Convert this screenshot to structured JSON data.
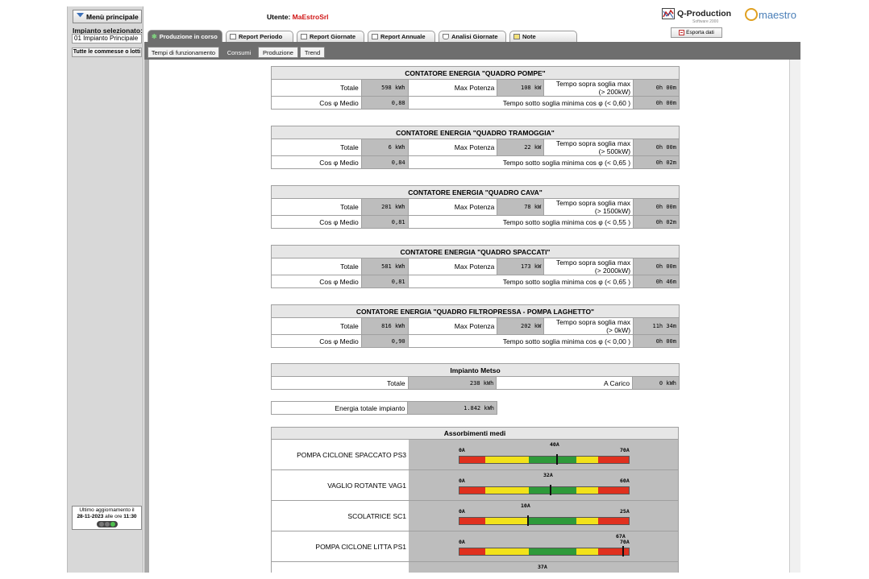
{
  "sidebar": {
    "menu_button": "Menù principale",
    "impianto_label": "Impianto selezionato:",
    "impianto_value": "01 Impianto Principale",
    "commesse_button": "Tutte le commesse o lotti",
    "update_line1": "Ultimo aggiornamento il",
    "update_date": "28-11-2023",
    "update_mid": "alle ore",
    "update_time": "11:30"
  },
  "header": {
    "user_label": "Utente:",
    "user_name": "MaEstroSrl",
    "brand": "Q-Production",
    "brand_sub": "Software 2000",
    "brand2": "maestro",
    "export_button": "Esporta dati"
  },
  "tabs": [
    {
      "label": "Produzione in corso",
      "active": true
    },
    {
      "label": "Report Periodo",
      "active": false
    },
    {
      "label": "Report Giornate",
      "active": false
    },
    {
      "label": "Report Annuale",
      "active": false
    },
    {
      "label": "Analisi Giornate",
      "active": false
    },
    {
      "label": "Note",
      "active": false
    }
  ],
  "subtabs": [
    {
      "label": "Tempi di funzionamento",
      "active": false
    },
    {
      "label": "Consumi",
      "active": true
    },
    {
      "label": "Produzione",
      "active": false
    },
    {
      "label": "Trend",
      "active": false
    }
  ],
  "labels": {
    "totale": "Totale",
    "max_potenza": "Max Potenza",
    "cos_medio": "Cos φ Medio",
    "tempo_sopra": "Tempo sopra soglia max",
    "tempo_sotto": "Tempo sotto soglia minima cos φ"
  },
  "meters": [
    {
      "title": "CONTATORE ENERGIA \"QUADRO POMPE\"",
      "totale": "598 kWh",
      "max_potenza": "108 kW",
      "soglia_max": "(> 200kW)",
      "tempo_sopra": "0h 00m",
      "cos": "0,88",
      "soglia_cos": "(< 0,60 )",
      "tempo_sotto": "0h 00m"
    },
    {
      "title": "CONTATORE ENERGIA \"QUADRO TRAMOGGIA\"",
      "totale": "6 kWh",
      "max_potenza": "22 kW",
      "soglia_max": "(> 500kW)",
      "tempo_sopra": "0h 00m",
      "cos": "0,84",
      "soglia_cos": "(< 0,65 )",
      "tempo_sotto": "0h 02m"
    },
    {
      "title": "CONTATORE ENERGIA \"QUADRO CAVA\"",
      "totale": "201 kWh",
      "max_potenza": "78 kW",
      "soglia_max": "(> 1500kW)",
      "tempo_sopra": "0h 00m",
      "cos": "0,81",
      "soglia_cos": "(< 0,55 )",
      "tempo_sotto": "0h 02m"
    },
    {
      "title": "CONTATORE ENERGIA \"QUADRO SPACCATI\"",
      "totale": "581 kWh",
      "max_potenza": "173 kW",
      "soglia_max": "(> 2000kW)",
      "tempo_sopra": "0h 00m",
      "cos": "0,81",
      "soglia_cos": "(< 0,65 )",
      "tempo_sotto": "0h 46m"
    },
    {
      "title": "CONTATORE ENERGIA \"QUADRO FILTROPRESSA - POMPA LAGHETTO\"",
      "totale": "816 kWh",
      "max_potenza": "202 kW",
      "soglia_max": "(> 0kW)",
      "tempo_sopra": "11h 34m",
      "cos": "0,90",
      "soglia_cos": "(< 0,00 )",
      "tempo_sotto": "0h 00m"
    }
  ],
  "metso": {
    "title": "Impianto Metso",
    "totale_label": "Totale",
    "totale": "238 kWh",
    "carico_label": "A Carico",
    "carico": "0 kWh"
  },
  "energia_totale": {
    "label": "Energia totale impianto",
    "value": "1.842 kWh"
  },
  "assorbimenti": {
    "title": "Assorbimenti medi",
    "items": [
      {
        "name": "POMPA CICLONE SPACCATO PS3",
        "min": "0A",
        "max": "70A",
        "current": "40A",
        "ratio": 0.5714
      },
      {
        "name": "VAGLIO ROTANTE VAG1",
        "min": "0A",
        "max": "60A",
        "current": "32A",
        "ratio": 0.5333
      },
      {
        "name": "SCOLATRICE SC1",
        "min": "0A",
        "max": "25A",
        "current": "10A",
        "ratio": 0.4
      },
      {
        "name": "POMPA CICLONE LITTA PS1",
        "min": "0A",
        "max": "70A",
        "current": "67A",
        "ratio": 0.9571
      },
      {
        "name": "",
        "min": "",
        "max": "",
        "current": "37A",
        "ratio": 0.5
      }
    ]
  },
  "colors": {
    "red": "#e0301e",
    "yellow": "#f2e21a",
    "green": "#2e9a3a",
    "header_gray": "#6e6e6e",
    "value_gray": "#bdbdbd",
    "user_red": "#d01515"
  }
}
